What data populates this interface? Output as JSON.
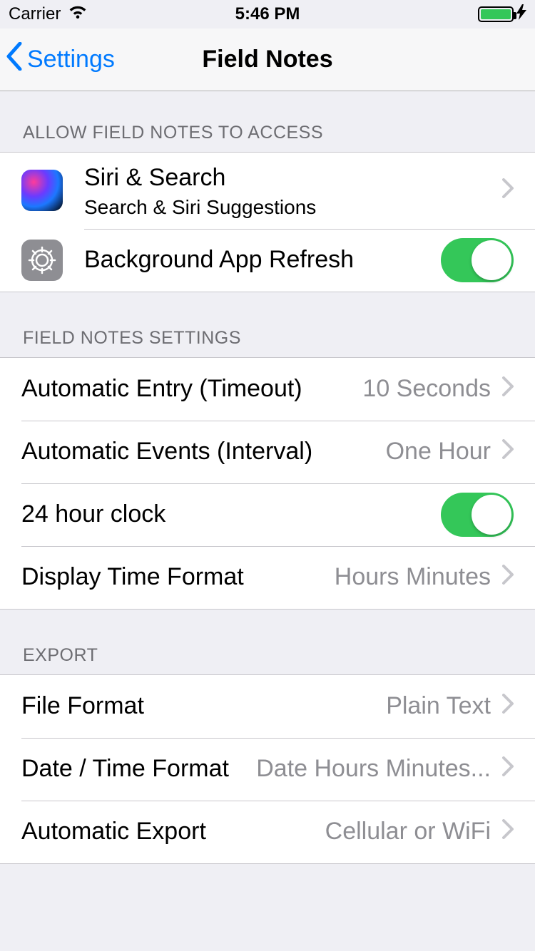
{
  "status": {
    "carrier": "Carrier",
    "time": "5:46 PM"
  },
  "nav": {
    "back": "Settings",
    "title": "Field Notes"
  },
  "sections": {
    "access_header": "ALLOW FIELD NOTES TO ACCESS",
    "settings_header": "FIELD NOTES SETTINGS",
    "export_header": "EXPORT"
  },
  "access": {
    "siri": {
      "title": "Siri & Search",
      "sub": "Search & Siri Suggestions"
    },
    "background": {
      "title": "Background App Refresh",
      "on": true
    }
  },
  "settings": {
    "timeout": {
      "title": "Automatic Entry (Timeout)",
      "value": "10 Seconds"
    },
    "interval": {
      "title": "Automatic Events (Interval)",
      "value": "One Hour"
    },
    "clock24": {
      "title": "24 hour clock",
      "on": true
    },
    "display_time": {
      "title": "Display Time Format",
      "value": "Hours Minutes"
    }
  },
  "export": {
    "file_format": {
      "title": "File Format",
      "value": "Plain Text"
    },
    "dt_format": {
      "title": "Date / Time Format",
      "value": "Date Hours Minutes..."
    },
    "auto_export": {
      "title": "Automatic Export",
      "value": "Cellular or WiFi"
    }
  }
}
